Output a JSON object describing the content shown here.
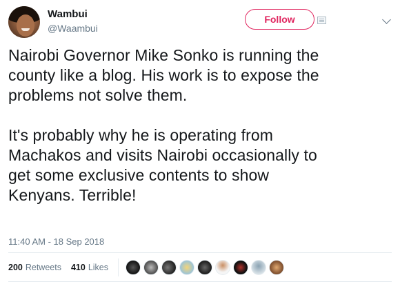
{
  "user": {
    "name": "Wambui",
    "handle": "@Waambui"
  },
  "follow_label": "Follow",
  "tweet": {
    "text": "Nairobi Governor Mike Sonko is running the\ncounty like a blog. His work is to expose the\nproblems not solve them.\n\nIt's probably why he is operating from\nMachakos and visits Nairobi occasionally to\nget some exclusive contents to show\nKenyans. Terrible!",
    "timestamp": "11:40 AM - 18 Sep 2018"
  },
  "stats": {
    "retweets_count": "200",
    "retweets_label": "Retweets",
    "likes_count": "410",
    "likes_label": "Likes"
  },
  "colors": {
    "accent": "#e0245e",
    "muted": "#657786",
    "text": "#14171a",
    "divider": "#e6ecf0"
  },
  "liker_avatars": [
    "avatar-dark",
    "avatar-gray",
    "avatar-group",
    "avatar-cartoon",
    "avatar-dark-round",
    "avatar-person",
    "avatar-black-red",
    "avatar-default",
    "avatar-warm"
  ]
}
